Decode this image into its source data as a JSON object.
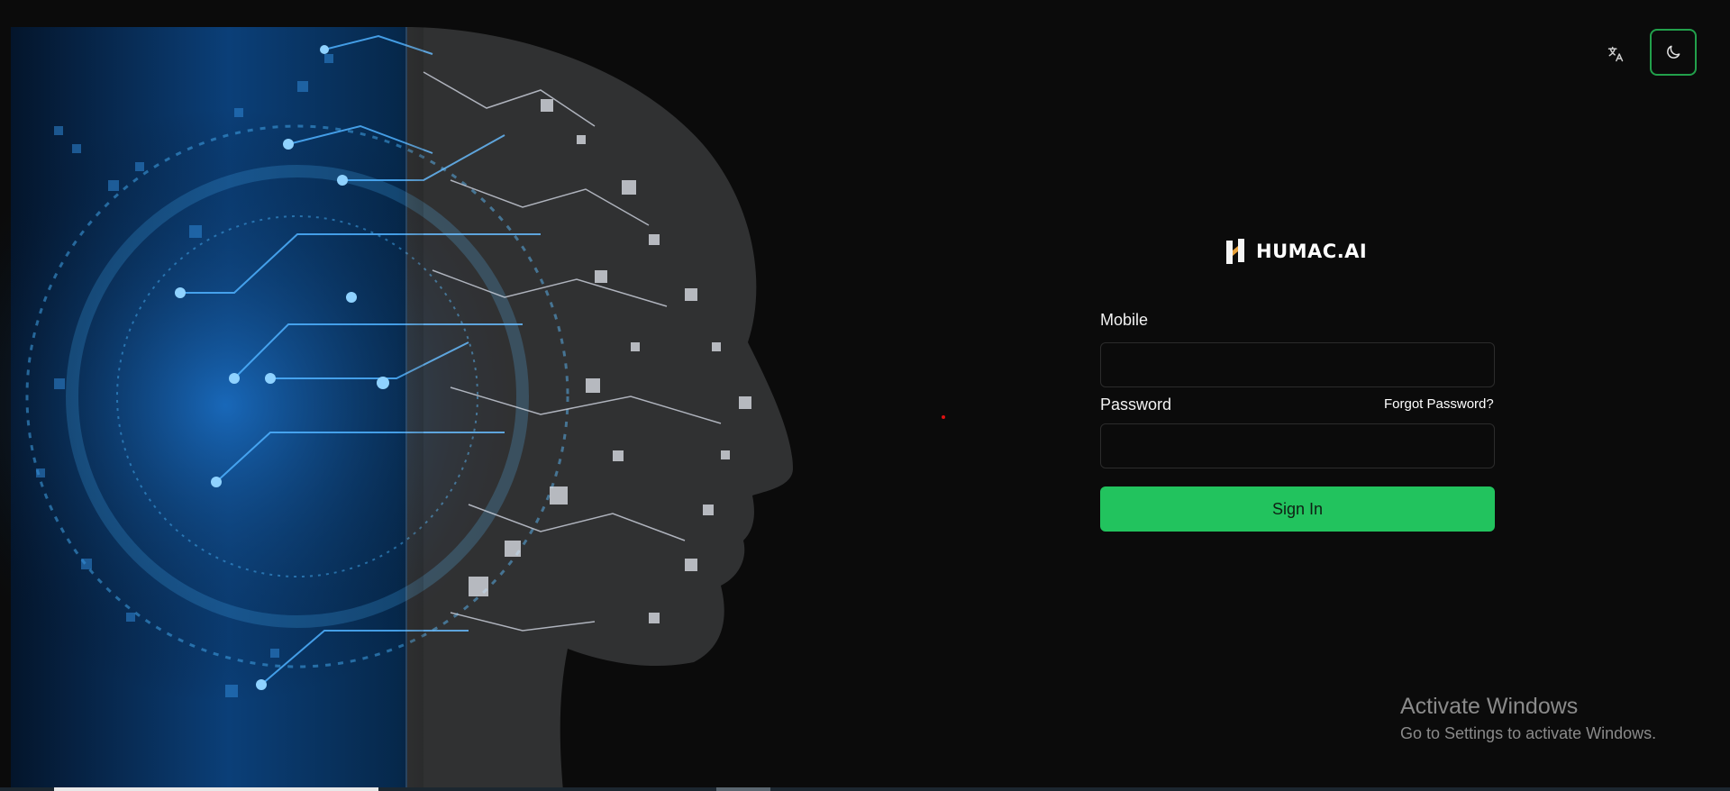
{
  "header": {
    "translate_icon": "translate-icon",
    "theme_icon": "moon-icon",
    "accent_color": "#22a04b"
  },
  "logo": {
    "text": "HUMAC.AI",
    "icon": "humac-logo-icon"
  },
  "form": {
    "mobile_label": "Mobile",
    "mobile_value": "",
    "password_label": "Password",
    "password_value": "",
    "forgot_label": "Forgot Password?",
    "signin_label": "Sign In",
    "signin_color": "#22c35e"
  },
  "hero": {
    "image": "ai-head-illustration"
  },
  "watermark": {
    "title": "Activate Windows",
    "subtitle": "Go to Settings to activate Windows."
  }
}
